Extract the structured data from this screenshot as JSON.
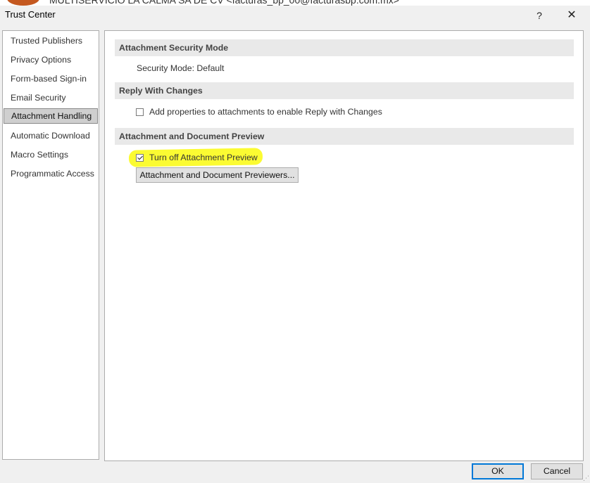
{
  "background_window": {
    "sender_text": "MULTISERVICIO LA CALMA SA DE CV <facturas_bp_00@facturasbp.com.mx>"
  },
  "window": {
    "title": "Trust Center",
    "help_label": "?",
    "close_label": "✕"
  },
  "sidebar": {
    "items": [
      {
        "label": "Trusted Publishers"
      },
      {
        "label": "Privacy Options"
      },
      {
        "label": "Form-based Sign-in"
      },
      {
        "label": "Email Security"
      },
      {
        "label": "Attachment Handling",
        "selected": true
      },
      {
        "label": "Automatic Download"
      },
      {
        "label": "Macro Settings"
      },
      {
        "label": "Programmatic Access"
      }
    ]
  },
  "main": {
    "attachment_security": {
      "header": "Attachment Security Mode",
      "mode_text": "Security Mode: Default"
    },
    "reply_with_changes": {
      "header": "Reply With Changes",
      "checkbox_label": "Add properties to attachments to enable Reply with Changes",
      "checked": false
    },
    "preview": {
      "header": "Attachment and Document Preview",
      "checkbox_label": "Turn off Attachment Preview",
      "checked": true,
      "highlight_color": "#fbfb32",
      "previewers_button": "Attachment and Document Previewers..."
    }
  },
  "footer": {
    "ok_label": "OK",
    "cancel_label": "Cancel"
  },
  "colors": {
    "accent": "#0078d7",
    "selected_nav": "#cfcfcf",
    "section_header_bg": "#e9e9e9"
  }
}
